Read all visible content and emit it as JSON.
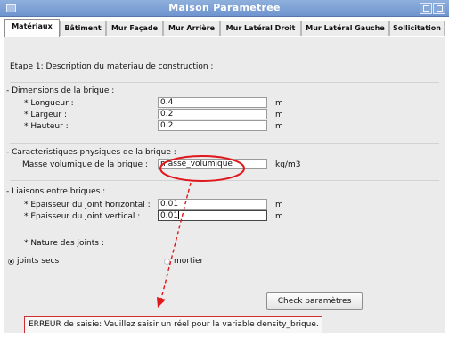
{
  "window": {
    "title": "Maison Parametree"
  },
  "tabs": [
    {
      "label": "Matériaux",
      "active": true
    },
    {
      "label": "Bâtiment",
      "active": false
    },
    {
      "label": "Mur Façade",
      "active": false
    },
    {
      "label": "Mur Arrière",
      "active": false
    },
    {
      "label": "Mur Latéral Droit",
      "active": false
    },
    {
      "label": "Mur Latéral Gauche",
      "active": false
    },
    {
      "label": "Sollicitation",
      "active": false
    }
  ],
  "step": {
    "label": "Etape 1:  Description du materiau de construction :"
  },
  "dimensions": {
    "header": "- Dimensions de la brique  :",
    "fields": [
      {
        "label": "* Longueur  :",
        "value": "0.4",
        "unit": "m"
      },
      {
        "label": "* Largeur  :",
        "value": "0.2",
        "unit": "m"
      },
      {
        "label": "* Hauteur  :",
        "value": "0.2",
        "unit": "m"
      }
    ]
  },
  "physical": {
    "header": "- Caracteristiques physiques de la brique  :",
    "label": "Masse volumique de la brique  :",
    "value": "masse_volumique",
    "unit": "kg/m3"
  },
  "joints": {
    "header": "- Liaisons entre briques  :",
    "fields": [
      {
        "label": "* Epaisseur du joint horizontal  :",
        "value": "0.01",
        "unit": "m"
      },
      {
        "label": "* Epaisseur du joint vertical  :",
        "value": "0.01",
        "unit": "m"
      }
    ],
    "nature_label": "* Nature des joints :",
    "options": [
      {
        "label": "joints secs",
        "selected": true
      },
      {
        "label": "mortier",
        "selected": false
      }
    ]
  },
  "check_button": {
    "label": "Check paramètres"
  },
  "status": {
    "message": "ERREUR de saisie: Veuillez saisir un réel pour la variable density_brique.",
    "color": "#d12f2f"
  },
  "annotation": {
    "color": "#e0171b"
  }
}
